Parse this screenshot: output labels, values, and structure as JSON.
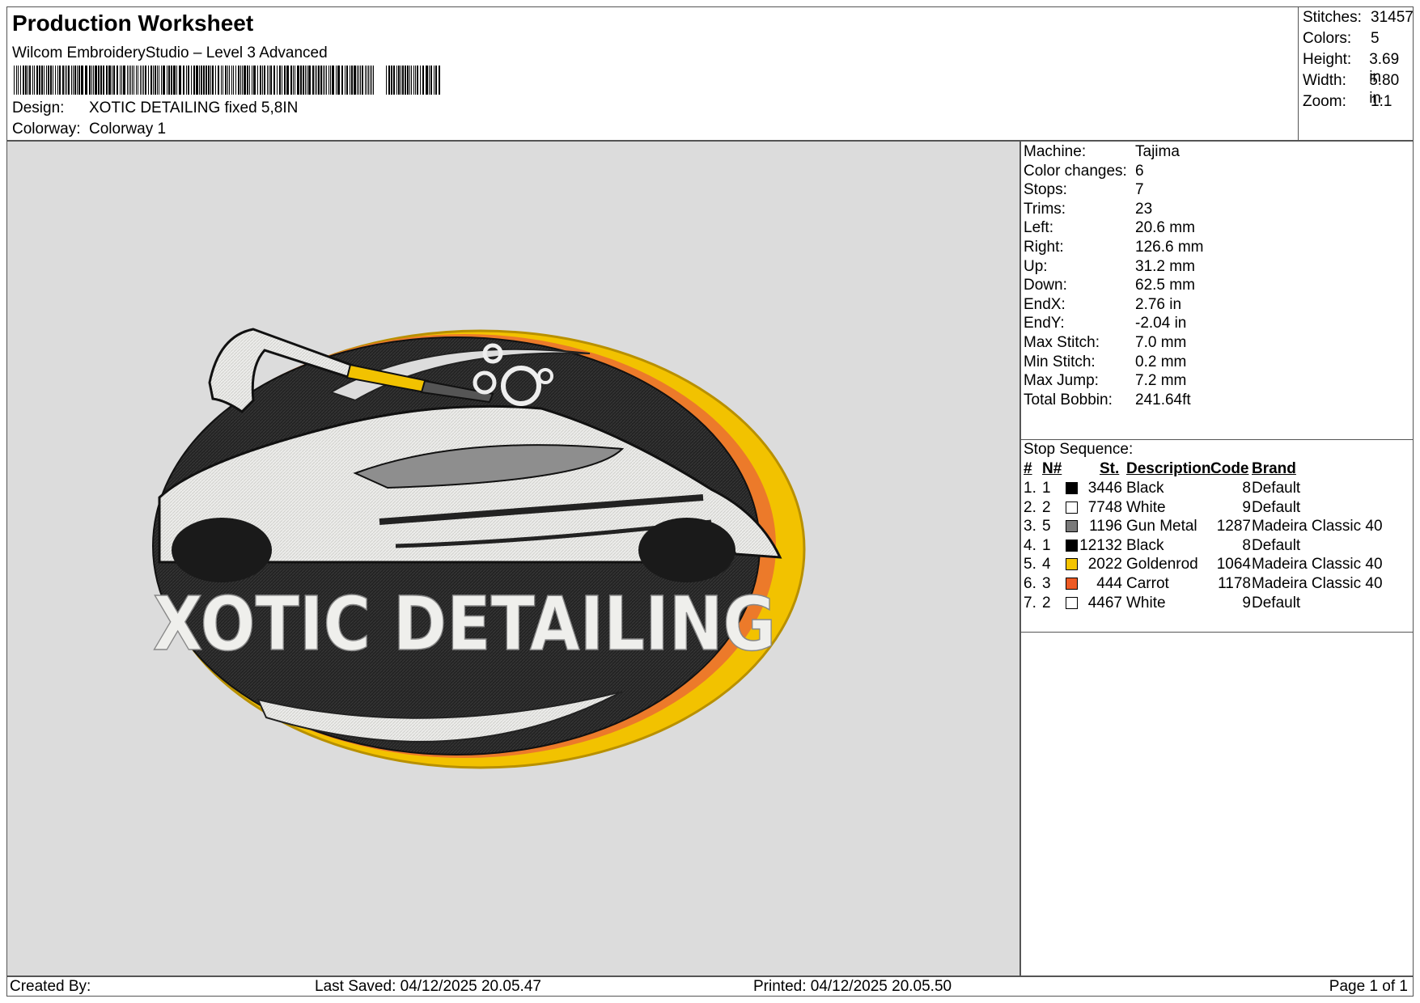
{
  "header": {
    "title": "Production Worksheet",
    "software": "Wilcom EmbroideryStudio – Level 3 Advanced",
    "design_label": "Design:",
    "design_value": "XOTIC DETAILING fixed 5,8IN",
    "colorway_label": "Colorway:",
    "colorway_value": "Colorway 1"
  },
  "stats": [
    {
      "k": "Stitches:",
      "v": "31457"
    },
    {
      "k": "Colors:",
      "v": "5"
    },
    {
      "k": "Height:",
      "v": "3.69 in"
    },
    {
      "k": "Width:",
      "v": "5.80 in"
    },
    {
      "k": "Zoom:",
      "v": "1:1"
    }
  ],
  "machine_info": [
    {
      "k": "Machine:",
      "v": "Tajima"
    },
    {
      "k": "Color changes:",
      "v": "6"
    },
    {
      "k": "Stops:",
      "v": "7"
    },
    {
      "k": "Trims:",
      "v": "23"
    },
    {
      "k": "Left:",
      "v": "20.6 mm"
    },
    {
      "k": "Right:",
      "v": "126.6 mm"
    },
    {
      "k": "Up:",
      "v": "31.2 mm"
    },
    {
      "k": "Down:",
      "v": "62.5 mm"
    },
    {
      "k": "EndX:",
      "v": "2.76 in"
    },
    {
      "k": "EndY:",
      "v": "-2.04 in"
    },
    {
      "k": "Max Stitch:",
      "v": "7.0 mm"
    },
    {
      "k": "Min Stitch:",
      "v": "0.2 mm"
    },
    {
      "k": "Max Jump:",
      "v": "7.2 mm"
    },
    {
      "k": "Total Bobbin:",
      "v": "241.64ft"
    }
  ],
  "stop_sequence": {
    "label": "Stop Sequence:",
    "headers": {
      "num": "#",
      "n": "N#",
      "st": "St.",
      "desc": "Description",
      "code": "Code",
      "brand": "Brand"
    },
    "rows": [
      {
        "num": "1.",
        "n": "1",
        "color": "#000000",
        "st": "3446",
        "desc": "Black",
        "code": "8",
        "brand": "Default"
      },
      {
        "num": "2.",
        "n": "2",
        "color": "#ffffff",
        "st": "7748",
        "desc": "White",
        "code": "9",
        "brand": "Default"
      },
      {
        "num": "3.",
        "n": "5",
        "color": "#7a7a7a",
        "st": "1196",
        "desc": "Gun Metal",
        "code": "1287",
        "brand": "Madeira Classic 40"
      },
      {
        "num": "4.",
        "n": "1",
        "color": "#000000",
        "st": "12132",
        "desc": "Black",
        "code": "8",
        "brand": "Default"
      },
      {
        "num": "5.",
        "n": "4",
        "color": "#f5c400",
        "st": "2022",
        "desc": "Goldenrod",
        "code": "1064",
        "brand": "Madeira Classic 40"
      },
      {
        "num": "6.",
        "n": "3",
        "color": "#ee5a24",
        "st": "444",
        "desc": "Carrot",
        "code": "1178",
        "brand": "Madeira Classic 40"
      },
      {
        "num": "7.",
        "n": "2",
        "color": "#ffffff",
        "st": "4467",
        "desc": "White",
        "code": "9",
        "brand": "Default"
      }
    ]
  },
  "design_preview": {
    "logo_text": "XOTIC DETAILING"
  },
  "footer": {
    "created_by": "Created By:",
    "last_saved": "Last Saved: 04/12/2025 20.05.47",
    "printed": "Printed: 04/12/2025 20.05.50",
    "page": "Page 1 of 1"
  }
}
